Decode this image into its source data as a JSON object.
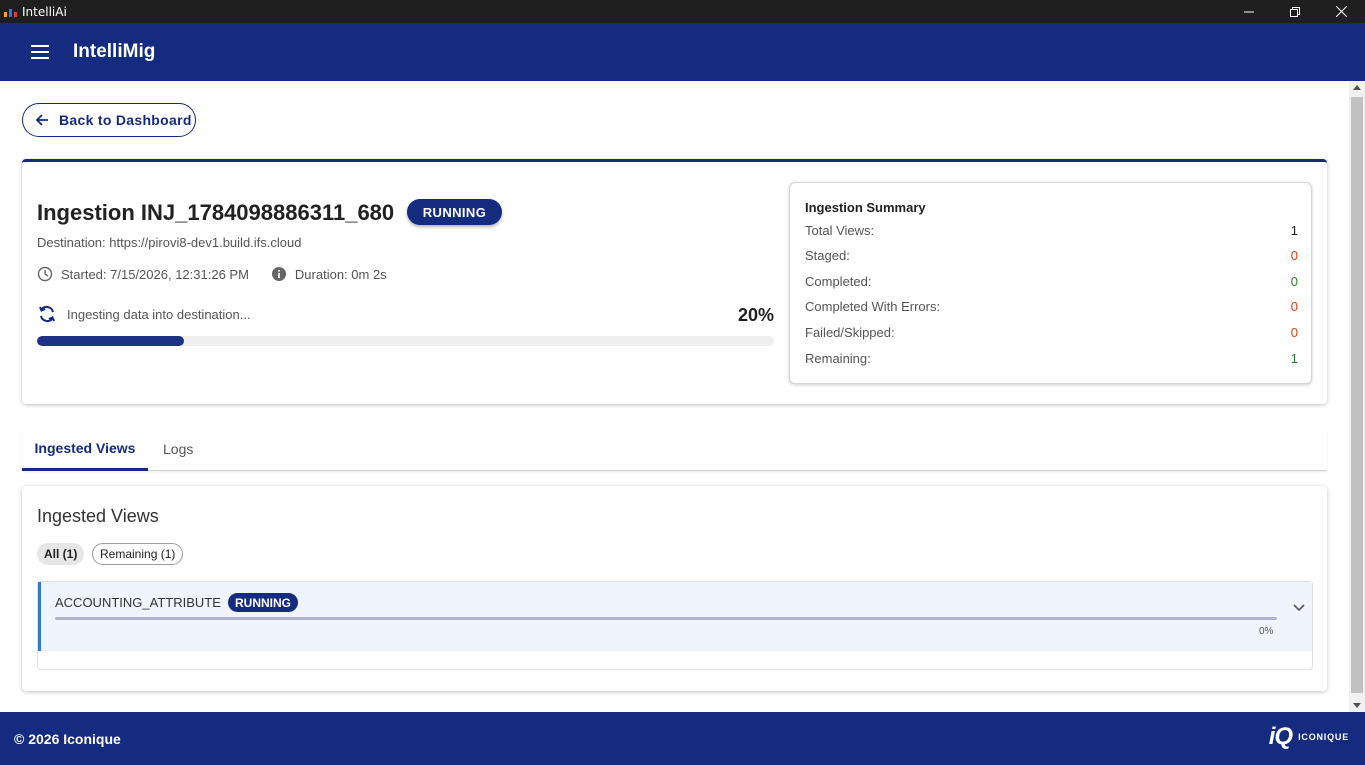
{
  "window": {
    "title": "IntelliAi"
  },
  "appbar": {
    "title": "IntelliMig"
  },
  "back_button": {
    "label": "Back to Dashboard"
  },
  "ingestion": {
    "title": "Ingestion INJ_1784098886311_680",
    "status": "RUNNING",
    "destination": "Destination: https://pirovi8-dev1.build.ifs.cloud",
    "started": "Started: 7/15/2026, 12:31:26 PM",
    "duration": "Duration: 0m 2s",
    "progress_label": "Ingesting data into destination...",
    "progress_text": "20%",
    "progress_value": 20
  },
  "summary": {
    "title": "Ingestion Summary",
    "rows": [
      {
        "label": "Total Views:",
        "value": "1"
      },
      {
        "label": "Staged:",
        "value": "0"
      },
      {
        "label": "Completed:",
        "value": "0"
      },
      {
        "label": "Completed With Errors:",
        "value": "0"
      },
      {
        "label": "Failed/Skipped:",
        "value": "0"
      },
      {
        "label": "Remaining:",
        "value": "1"
      }
    ]
  },
  "tabs": [
    {
      "label": "Ingested Views",
      "active": true
    },
    {
      "label": "Logs",
      "active": false
    }
  ],
  "views": {
    "title": "Ingested Views",
    "filters": [
      {
        "label": "All (1)",
        "selected": true
      },
      {
        "label": "Remaining (1)",
        "selected": false
      }
    ],
    "items": [
      {
        "name": "ACCOUNTING_ATTRIBUTE",
        "status": "RUNNING",
        "progress_text": "0%",
        "progress_value": 0
      }
    ]
  },
  "footer": {
    "copyright": "© 2026 Iconique",
    "brand_mark": "iQ",
    "brand_name": "ICONIQUE"
  },
  "colors": {
    "primary": "#152b80",
    "success": "#2e7d32",
    "error": "#d84315",
    "accent_border": "#2f7ad4"
  },
  "icons": {
    "menu": "menu-icon",
    "back": "arrow-left-icon",
    "clock": "clock-icon",
    "info": "info-icon",
    "sync": "sync-icon",
    "chevron": "chevron-down-icon"
  }
}
